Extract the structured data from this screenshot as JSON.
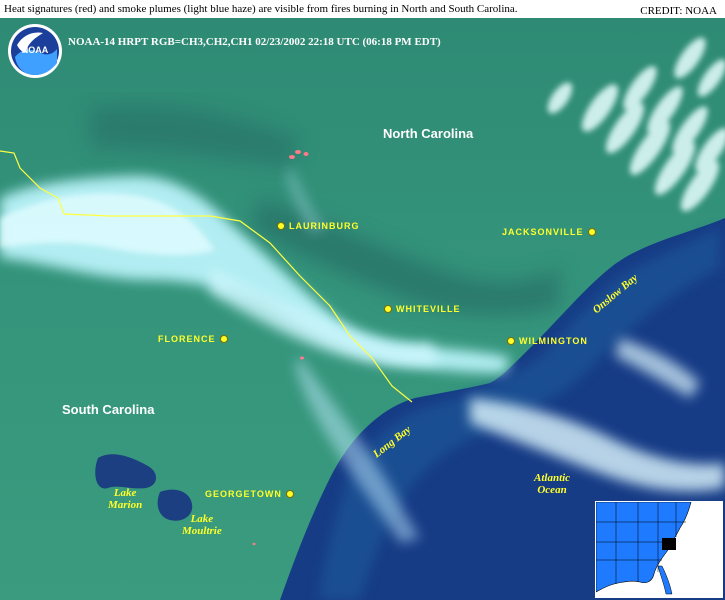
{
  "caption": "Heat signatures (red) and smoke plumes (light blue haze) are visible from fires burning in North and South Carolina.",
  "credit": "CREDIT: NOAA",
  "header_line": "NOAA-14  HRPT  RGB=CH3,CH2,CH1  02/23/2002  22:18 UTC  (06:18 PM EDT)",
  "logo": {
    "text": "NOAA",
    "icon": "noaa-logo-icon"
  },
  "states": {
    "north_carolina": "North Carolina",
    "south_carolina": "South Carolina"
  },
  "cities": {
    "laurinburg": "LAURINBURG",
    "jacksonville": "JACKSONVILLE",
    "whiteville": "WHITEVILLE",
    "wilmington": "WILMINGTON",
    "florence": "FLORENCE",
    "georgetown": "GEORGETOWN"
  },
  "water": {
    "onslow_bay": "Onslow Bay",
    "long_bay": "Long Bay",
    "atlantic_line1": "Atlantic",
    "atlantic_line2": "Ocean",
    "lake_marion_line1": "Lake",
    "lake_marion_line2": "Marion",
    "lake_moultrie_line1": "Lake",
    "lake_moultrie_line2": "Moultrie"
  },
  "colors": {
    "land": "#2f8f7a",
    "ocean": "#173c86",
    "cloud": "#bff7ff",
    "state_line": "#ffff40",
    "city_marker": "#ffff2a",
    "heat_signature": "#ff7a8a"
  }
}
